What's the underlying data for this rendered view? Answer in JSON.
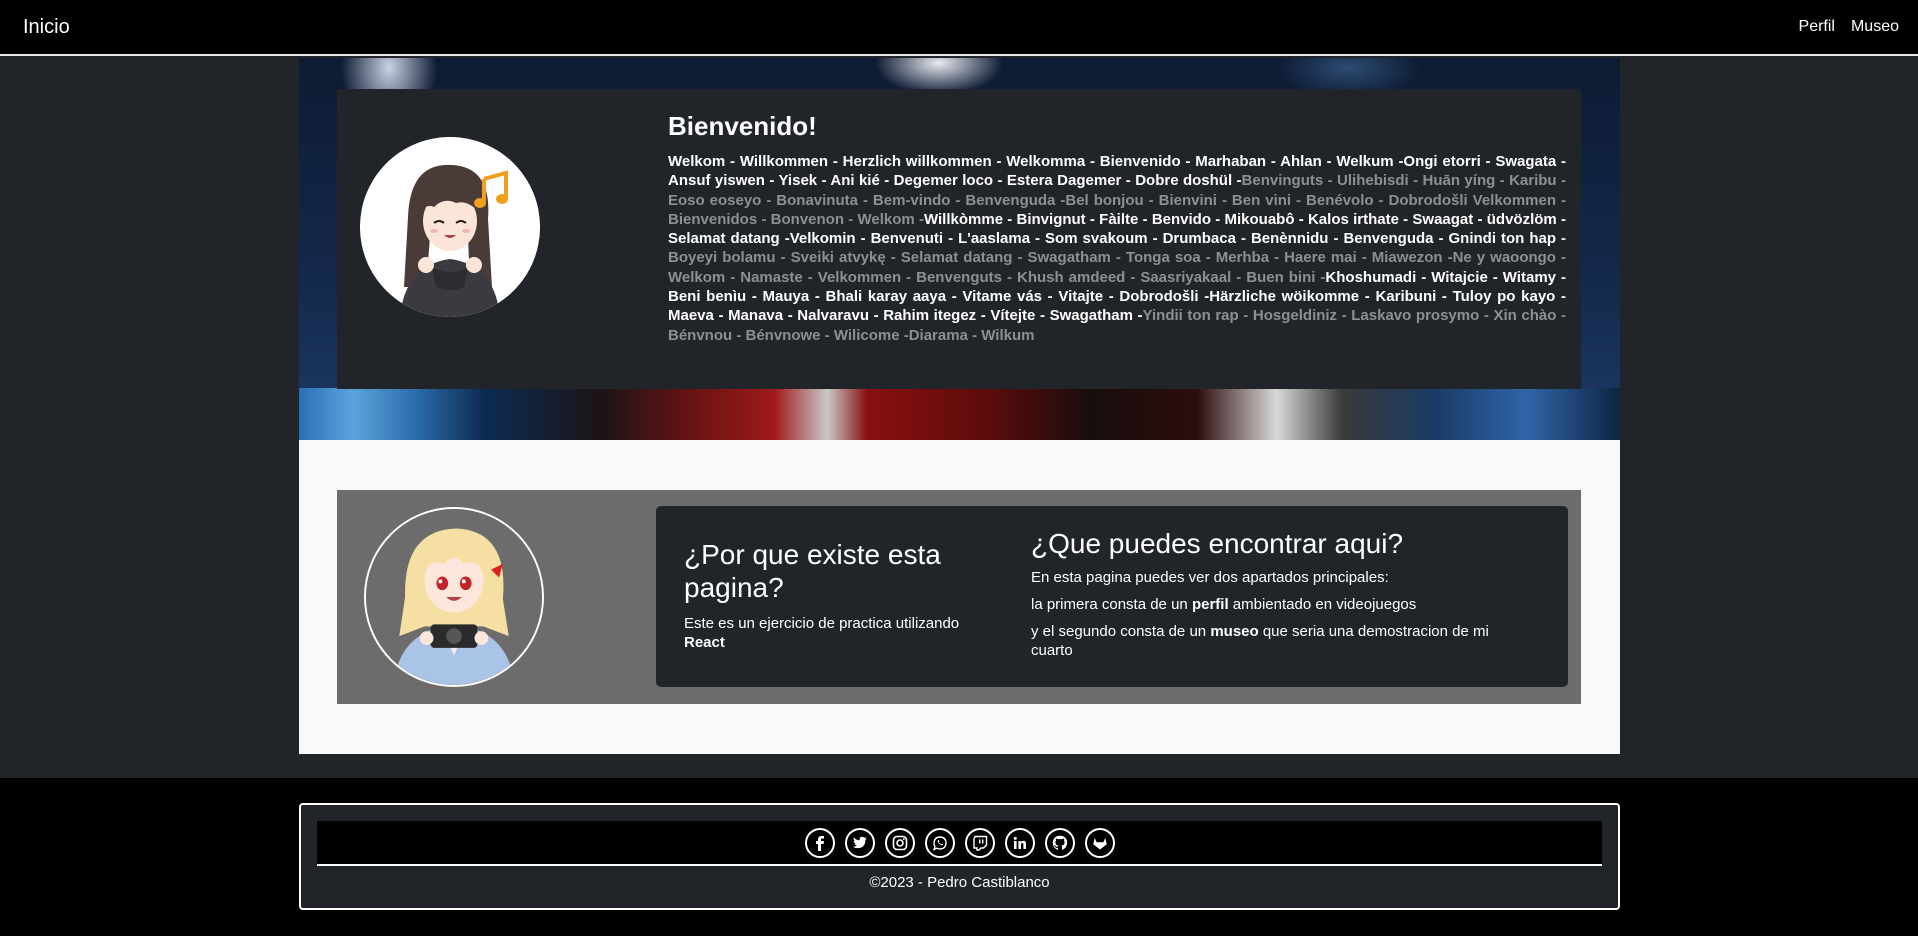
{
  "navbar": {
    "brand": "Inicio",
    "links": [
      {
        "label": "Perfil"
      },
      {
        "label": "Museo"
      }
    ]
  },
  "hero": {
    "title": "Bienvenido!",
    "welcome_segments": [
      {
        "text": "Welkom - Willkommen - Herzlich willkommen - Welkomma - Bienvenido - Marhaban - Ahlan - Welkum -Ongi etorri - Swagata - Ansuf yiswen - Yisek - Ani kié - Degemer loco - Estera Dagemer - Dobre doshül -",
        "muted": false
      },
      {
        "text": "Benvinguts - Ulihebisdi - Huān yíng - Karibu - Eoso eoseyo - Bonavinuta - Bem-vindo - Benvenguda -",
        "muted": true
      },
      {
        "text": "Bel bonjou - Bienvini - Ben vini - Benévolo - Dobrodošli Velkommen - Bienvenidos - Bonvenon - Welkom -",
        "muted": true
      },
      {
        "text": "Willkòmme - Binvignut - Fàilte - Benvido - Mikouabô - Kalos irthate - Swaagat - üdvözlöm - Selamat datang -Velkomin - Benvenuti - L'aaslama - Som svakoum - Drumbaca - Benènnidu - Benvenguda - Gnindi ton hap -",
        "muted": false
      },
      {
        "text": "Boyeyi bolamu - Sveiki atvykę - Selamat datang - Swagatham - Tonga soa - Merhba - Haere mai - Miawezon -",
        "muted": true
      },
      {
        "text": "Ne y waoongo - Welkom - Namaste - Velkommen - Benvenguts - Khush amdeed - Saasriyakaal - Buen bini -",
        "muted": true
      },
      {
        "text": "Khoshumadi - Witajcie - Witamy - Beni benìu - Mauya - Bhali karay aaya - Vitame vás - Vitajte - Dobrodošli -",
        "muted": false
      },
      {
        "text": "Härzliche wöikomme - Karibuni - Tuloy po kayo - Maeva - Manava - Nalvaravu - Rahim itegez - Vítejte - Swagatham -",
        "muted": false
      },
      {
        "text": "Yindii ton rap - Hosgeldiniz - Laskavo prosymo - Xin chào - Bénvnou - Bénvnowe - Wilicome -Diarama - Wilkum",
        "muted": true
      }
    ]
  },
  "about": {
    "why_title": "¿Por que existe esta pagina?",
    "why_text": "Este es un ejercicio de practica utilizando",
    "why_strong": "React",
    "what_title": "¿Que puedes encontrar aqui?",
    "what_intro": "En esta pagina puedes ver dos apartados principales:",
    "line1_pre": "la primera consta de un",
    "line1_strong": "perfil",
    "line1_post": "ambientado en videojuegos",
    "line2_pre": "y el segundo consta de un",
    "line2_strong": "museo",
    "line2_post": "que seria una demostracion de mi cuarto"
  },
  "footer": {
    "social_icons": [
      "facebook-icon",
      "twitter-icon",
      "instagram-icon",
      "whatsapp-icon",
      "twitch-icon",
      "linkedin-icon",
      "github-icon",
      "gitlab-icon"
    ],
    "copyright": "©2023 - Pedro Castiblanco"
  }
}
